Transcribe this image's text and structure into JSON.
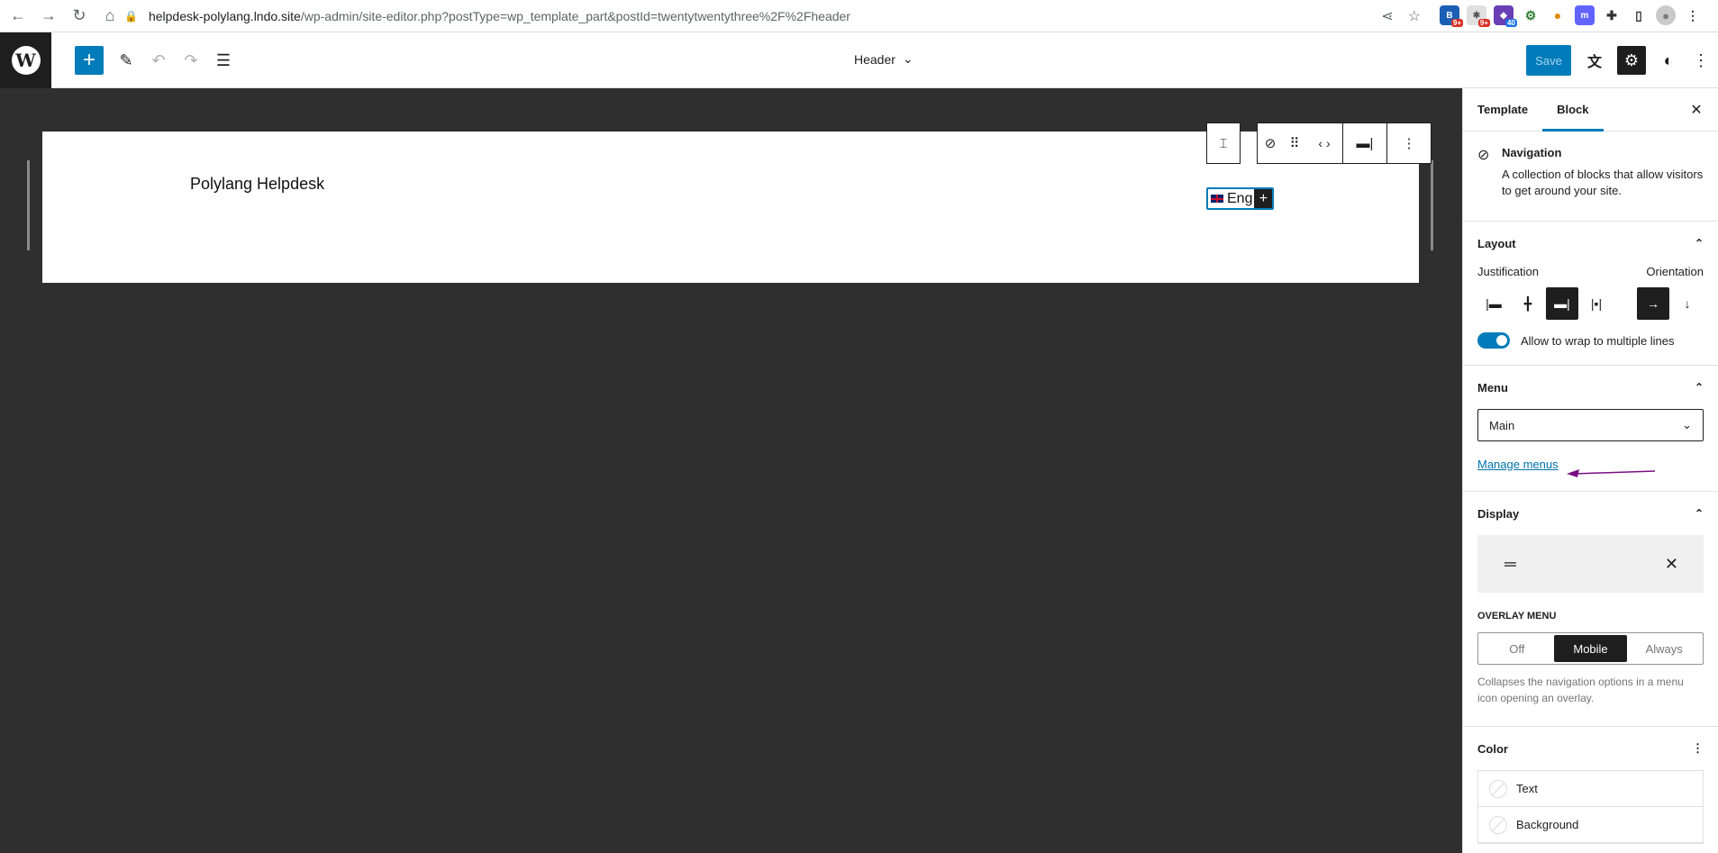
{
  "browser": {
    "url_host": "helpdesk-polylang.lndo.site",
    "url_path": "/wp-admin/site-editor.php?postType=wp_template_part&postId=twentytwentythree%2F%2Fheader",
    "ext_badges": [
      "9+",
      "9+",
      "40"
    ]
  },
  "header": {
    "doc_title": "Header",
    "save_label": "Save"
  },
  "canvas": {
    "site_title": "Polylang Helpdesk",
    "nav_item_label": "Eng"
  },
  "sidebar": {
    "tabs": [
      "Template",
      "Block"
    ],
    "block_title": "Navigation",
    "block_desc": "A collection of blocks that allow visitors to get around your site.",
    "layout": {
      "title": "Layout",
      "justification_label": "Justification",
      "orientation_label": "Orientation",
      "wrap_label": "Allow to wrap to multiple lines"
    },
    "menu": {
      "title": "Menu",
      "selected": "Main",
      "manage_link": "Manage menus"
    },
    "display": {
      "title": "Display",
      "overlay_label": "OVERLAY MENU",
      "options": [
        "Off",
        "Mobile",
        "Always"
      ],
      "help": "Collapses the navigation options in a menu icon opening an overlay."
    },
    "color": {
      "title": "Color",
      "items": [
        "Text",
        "Background"
      ]
    }
  },
  "colors": {
    "accent": "#007cba",
    "annotation_arrow": "#7a0f84"
  }
}
